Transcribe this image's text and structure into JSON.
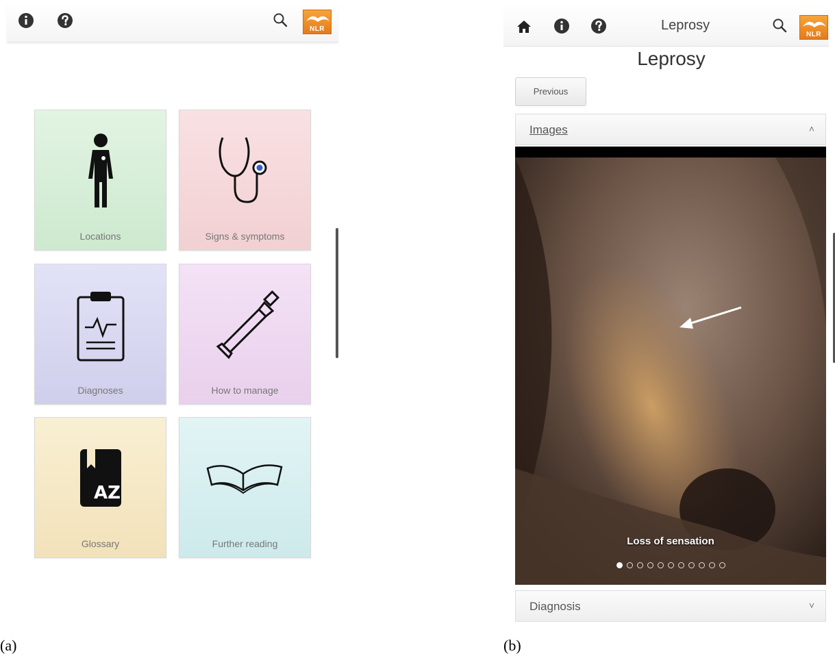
{
  "panel_a": {
    "caption": "(a)",
    "toolbar": {
      "info_icon": "info-circle-icon",
      "help_icon": "question-circle-icon",
      "search_icon": "search-icon",
      "logo_text": "NLR"
    },
    "tiles": [
      {
        "label": "Locations",
        "icon": "body-figure-icon",
        "color": "#d4efd6"
      },
      {
        "label": "Signs & symptoms",
        "icon": "stethoscope-icon",
        "color": "#f6d7da"
      },
      {
        "label": "Diagnoses",
        "icon": "clipboard-icon",
        "color": "#d8d8f1"
      },
      {
        "label": "How to manage",
        "icon": "ointment-tube-icon",
        "color": "#efd9f2"
      },
      {
        "label": "Glossary",
        "icon": "glossary-book-icon",
        "color": "#f6e9c7"
      },
      {
        "label": "Further reading",
        "icon": "open-book-icon",
        "color": "#d7eff0"
      }
    ]
  },
  "panel_b": {
    "caption": "(b)",
    "toolbar": {
      "home_icon": "home-icon",
      "info_icon": "info-circle-icon",
      "help_icon": "question-circle-icon",
      "title": "Leprosy",
      "search_icon": "search-icon",
      "logo_text": "NLR"
    },
    "page_title": "Leprosy",
    "previous_label": "Previous",
    "sections": [
      {
        "label": "Images",
        "arrow": "˄"
      },
      {
        "label": "Diagnosis",
        "arrow": "˅"
      }
    ],
    "slide": {
      "caption": "Loss of sensation",
      "current": 1,
      "total": 11
    }
  }
}
